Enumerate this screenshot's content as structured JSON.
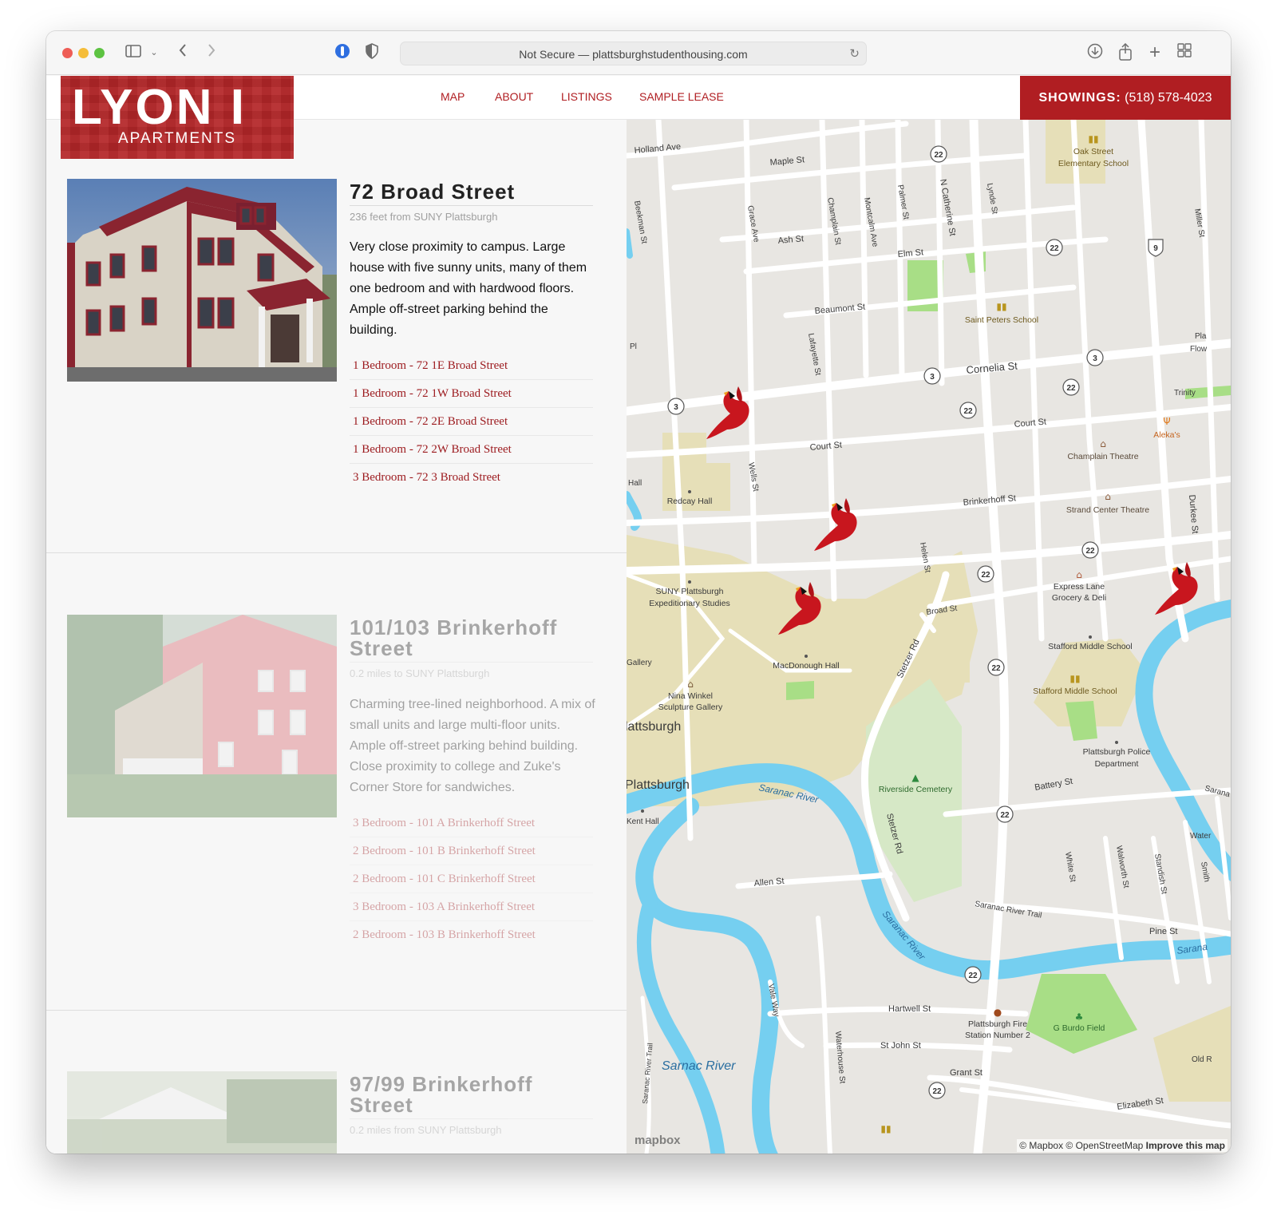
{
  "browser": {
    "url": "Not Secure — plattsburghstudenthousing.com"
  },
  "site": {
    "logo_big": "LYON I",
    "logo_small": "APARTMENTS",
    "nav": [
      "MAP",
      "ABOUT",
      "LISTINGS",
      "SAMPLE LEASE"
    ],
    "showings_label": "SHOWINGS:",
    "showings_phone": "(518) 578-4023"
  },
  "listings": [
    {
      "title": "72 Broad Street",
      "distance": "236 feet from SUNY Plattsburgh",
      "description": "Very close proximity to campus. Large house with five sunny units, many of them one bedroom and with hardwood floors. Ample off-street parking behind the building.",
      "units": [
        "1 Bedroom - 72 1E Broad Street",
        "1 Bedroom - 72 1W Broad Street",
        "1 Bedroom - 72 2E Broad Street",
        "1 Bedroom - 72 2W Broad Street",
        "3 Bedroom - 72 3 Broad Street"
      ]
    },
    {
      "title": "101/103 Brinkerhoff Street",
      "distance": "0.2 miles to SUNY Plattsburgh",
      "description": "Charming tree-lined neighborhood. A mix of small units and large multi-floor units. Ample off-street parking behind building. Close proximity to college and Zuke's Corner Store for sandwiches.",
      "units": [
        "3 Bedroom - 101 A Brinkerhoff Street",
        "2 Bedroom - 101 B Brinkerhoff Street",
        "2 Bedroom - 101 C Brinkerhoff Street",
        "3 Bedroom - 103 A Brinkerhoff Street",
        "2 Bedroom - 103 B Brinkerhoff Street"
      ]
    },
    {
      "title": "97/99 Brinkerhoff Street",
      "distance": "0.2 miles from SUNY Plattsburgh"
    }
  ],
  "map": {
    "streets": [
      "Holland Ave",
      "Maple St",
      "Ash St",
      "Elm St",
      "Beaumont St",
      "Cornelia St",
      "Court St",
      "Brinkerhoff St",
      "Broad St",
      "Beekman St",
      "Grace Ave",
      "Champlain St",
      "Montcalm Ave",
      "Palmer St",
      "N Catherine St",
      "Lynde St",
      "Lafayette St",
      "Wells St",
      "Helen St",
      "Stetzer Rd",
      "Allen St",
      "Hartwell St",
      "St John St",
      "Grant St",
      "Elizabeth St",
      "Battery St",
      "Pine St",
      "White St",
      "Walworth St",
      "Standish St",
      "Saranac River Trail",
      "Vale Way",
      "Waterhouse St",
      "Durkee St",
      "Miller St",
      "Trinity",
      "Pl",
      "Hall",
      "Gallery",
      "Kent Hall",
      "Plattsburgh",
      "lattsburgh",
      "Smith",
      "Water",
      "Sarana",
      "Old R",
      "Pla",
      "Flow"
    ],
    "places": [
      "Oak Street Elementary School",
      "Saint Peters School",
      "Aleka's",
      "Champlain Theatre",
      "Strand Center Theatre",
      "Redcay Hall",
      "SUNY Plattsburgh Expeditionary Studies",
      "Express Lane Grocery & Deli",
      "Stafford Middle School",
      "MacDonough Hall",
      "Nina Winkel Sculpture Gallery",
      "Riverside Cemetery",
      "Plattsburgh Police Department",
      "Plattsburgh Fire Station Number 2",
      "G Burdo Field"
    ],
    "rivers": [
      "Saranac River",
      "Sarnac River"
    ],
    "route_shields": [
      "22",
      "3",
      "9"
    ],
    "attribution_left": "© Mapbox © OpenStreetMap",
    "attribution_right": "Improve this map",
    "mapbox_logo": "mapbox",
    "colors": {
      "land": "#e8e6e2",
      "road": "#ffffff",
      "water": "#75cff0",
      "campus": "#e6dfb8",
      "park": "#a8de86",
      "accent": "#b01e22"
    }
  }
}
